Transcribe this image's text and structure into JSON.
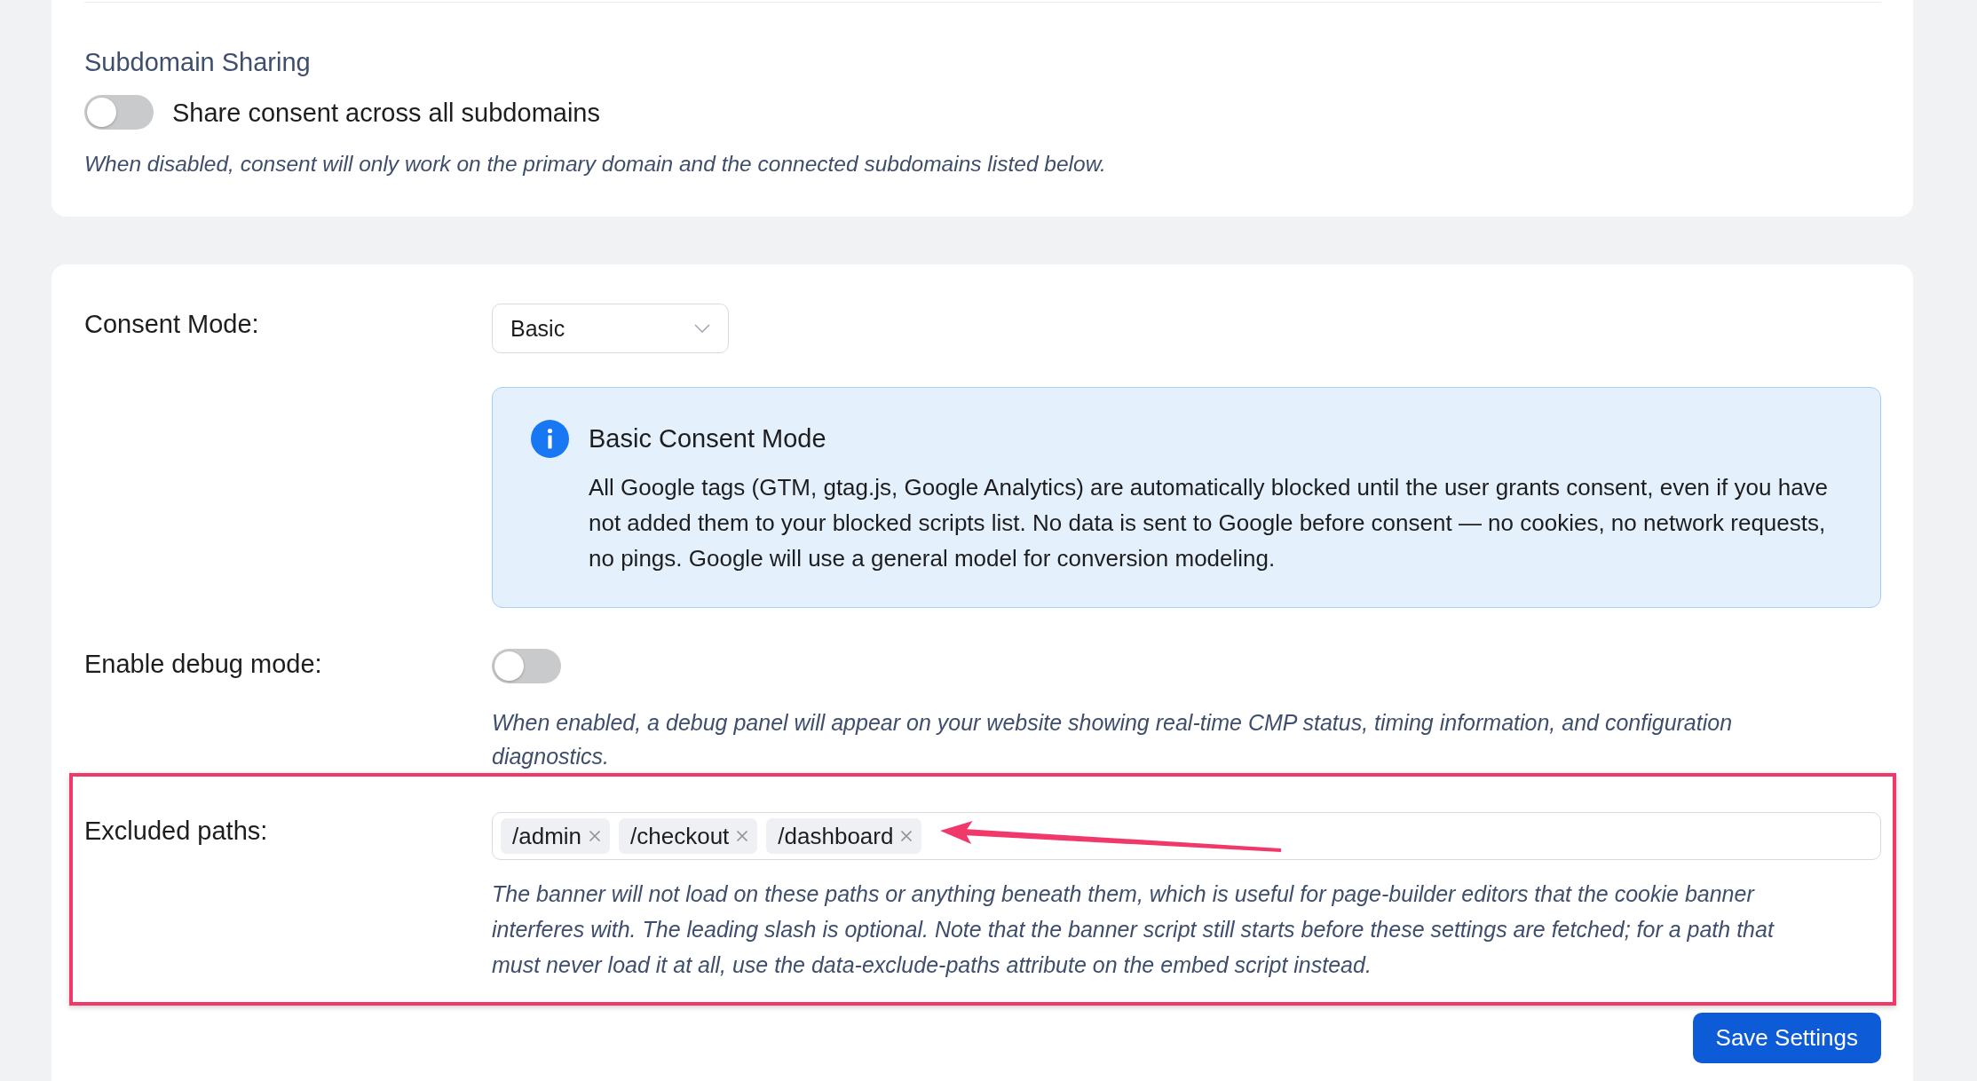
{
  "subdomain_sharing": {
    "title": "Subdomain Sharing",
    "toggle": {
      "label": "Share consent across all subdomains",
      "on": false
    },
    "help": "When disabled, consent will only work on the primary domain and the connected subdomains listed below."
  },
  "settings": {
    "consent_mode": {
      "label": "Consent Mode:",
      "dropdown": {
        "value": "Basic"
      },
      "info": {
        "title": "Basic Consent Mode",
        "body": "All Google tags (GTM, gtag.js, Google Analytics) are automatically blocked until the user grants consent, even if you have not added them to your blocked scripts list. No data is sent to Google before consent — no cookies, no network requests, no pings. Google will use a general model for conversion modeling."
      }
    },
    "debug_mode": {
      "label": "Enable debug mode:",
      "on": false,
      "help": "When enabled, a debug panel will appear on your website showing real-time CMP status, timing information, and configuration diagnostics."
    },
    "excluded_paths": {
      "label": "Excluded paths:",
      "highlighted": true,
      "tags": [
        {
          "text": "/admin"
        },
        {
          "text": "/checkout"
        },
        {
          "text": "/dashboard"
        }
      ],
      "help": "The banner will not load on these paths or anything beneath them, which is useful for page-builder editors that the cookie banner interferes with. The leading slash is optional. Note that the banner script still starts before these settings are fetched; for a path that must never load it at all, use the data-exclude-paths attribute on the embed script instead."
    },
    "save_button": "Save Settings"
  }
}
